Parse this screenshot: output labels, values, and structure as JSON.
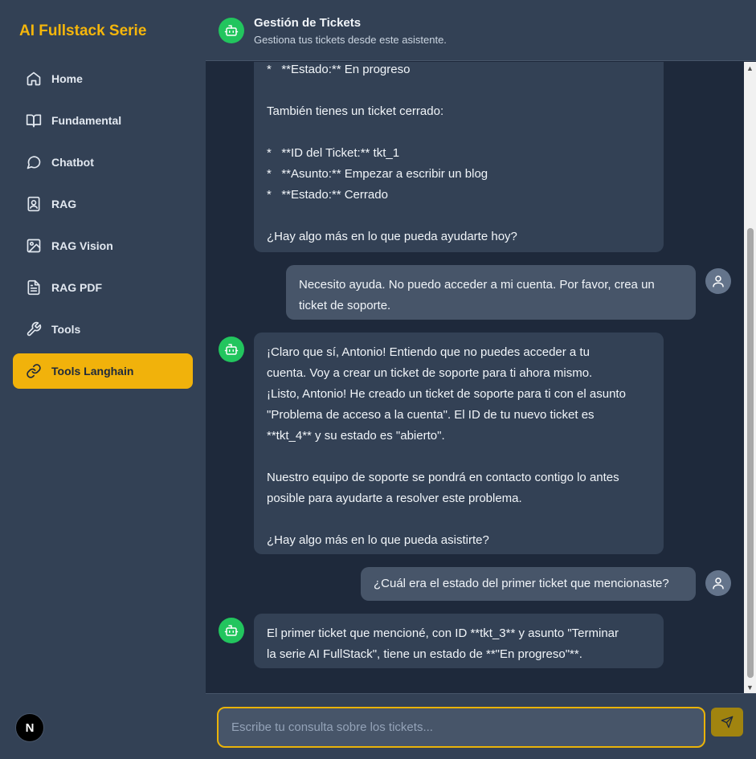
{
  "sidebar": {
    "brand": "AI Fullstack Serie",
    "items": [
      {
        "label": "Home",
        "icon": "home-icon"
      },
      {
        "label": "Fundamental",
        "icon": "book-icon"
      },
      {
        "label": "Chatbot",
        "icon": "message-circle-icon"
      },
      {
        "label": "RAG",
        "icon": "contact-book-icon"
      },
      {
        "label": "RAG Vision",
        "icon": "image-icon"
      },
      {
        "label": "RAG PDF",
        "icon": "file-text-icon"
      },
      {
        "label": "Tools",
        "icon": "wrench-icon"
      },
      {
        "label": "Tools Langhain",
        "icon": "link-icon",
        "active": true
      }
    ],
    "footer_badge": "N"
  },
  "header": {
    "title": "Gestión de Tickets",
    "subtitle": "Gestiona tus tickets desde este asistente."
  },
  "messages": [
    {
      "role": "bot",
      "text": "*   **Estado:** En progreso\n\nTambién tienes un ticket cerrado:\n\n*   **ID del Ticket:** tkt_1\n*   **Asunto:** Empezar a escribir un blog\n*   **Estado:** Cerrado\n\n¿Hay algo más en lo que pueda ayudarte hoy?"
    },
    {
      "role": "user",
      "text": "Necesito ayuda. No puedo acceder a mi cuenta. Por favor, crea un\nticket de soporte."
    },
    {
      "role": "bot",
      "text": "¡Claro que sí, Antonio! Entiendo que no puedes acceder a tu\ncuenta. Voy a crear un ticket de soporte para ti ahora mismo.\n¡Listo, Antonio! He creado un ticket de soporte para ti con el asunto\n\"Problema de acceso a la cuenta\". El ID de tu nuevo ticket es\n**tkt_4** y su estado es \"abierto\".\n\nNuestro equipo de soporte se pondrá en contacto contigo lo antes\nposible para ayudarte a resolver este problema.\n\n¿Hay algo más en lo que pueda asistirte?"
    },
    {
      "role": "user",
      "text": "¿Cuál era el estado del primer ticket que mencionaste?"
    },
    {
      "role": "bot",
      "text": "El primer ticket que mencioné, con ID **tkt_3** y asunto \"Terminar\nla serie AI FullStack\", tiene un estado de **\"En progreso\"**."
    }
  ],
  "input": {
    "placeholder": "Escribe tu consulta sobre los tickets...",
    "value": ""
  },
  "colors": {
    "accent": "#f1b20b",
    "bot_avatar": "#22c55e",
    "sidebar_bg": "#334155",
    "chat_bg": "#1e293b"
  }
}
